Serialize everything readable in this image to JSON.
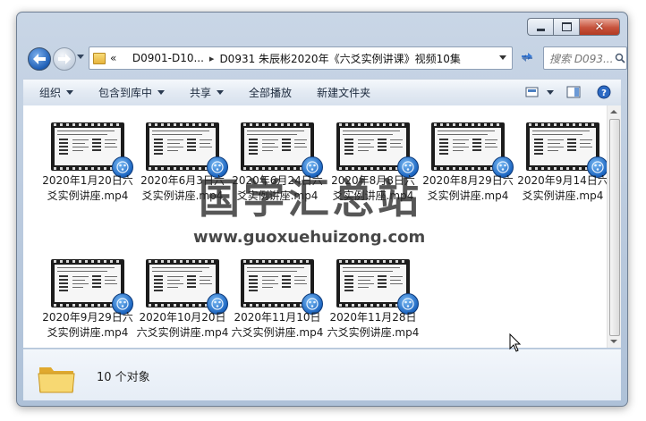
{
  "window": {
    "buttons": {
      "minimize": "minimize-icon",
      "maximize": "maximize-icon",
      "close": "close-icon"
    }
  },
  "address_bar": {
    "overflow": "«",
    "crumbs": [
      "D0901-D10...",
      "D0931 朱辰彬2020年《六爻实例讲课》视频10集"
    ],
    "separator": "▸"
  },
  "search": {
    "placeholder": "搜索 D093..."
  },
  "toolbar": {
    "organize": "组织",
    "include_library": "包含到库中",
    "share": "共享",
    "play_all": "全部播放",
    "new_folder": "新建文件夹"
  },
  "files": [
    {
      "name": "2020年1月20日六爻实例讲座.mp4"
    },
    {
      "name": "2020年6月3日六爻实例讲座.mp4"
    },
    {
      "name": "2020年6月24日六爻实例讲座.mp4"
    },
    {
      "name": "2020年8月8日六爻实例讲座.mp4"
    },
    {
      "name": "2020年8月29日六爻实例讲座.mp4"
    },
    {
      "name": "2020年9月14日六爻实例讲座.mp4"
    },
    {
      "name": "2020年9月29日六爻实例讲座.mp4"
    },
    {
      "name": "2020年10月20日六爻实例讲座.mp4"
    },
    {
      "name": "2020年11月10日六爻实例讲座.mp4"
    },
    {
      "name": "2020年11月28日六爻实例讲座.mp4"
    }
  ],
  "details": {
    "item_count": "10 个对象"
  },
  "watermark": {
    "chinese": "国学汇总站",
    "url": "www.guoxuehuizong.com"
  },
  "colors": {
    "toolbar_text": "#1c2a3d",
    "accent_blue": "#1d66c1",
    "folder_yellow": "#f2c94c"
  }
}
